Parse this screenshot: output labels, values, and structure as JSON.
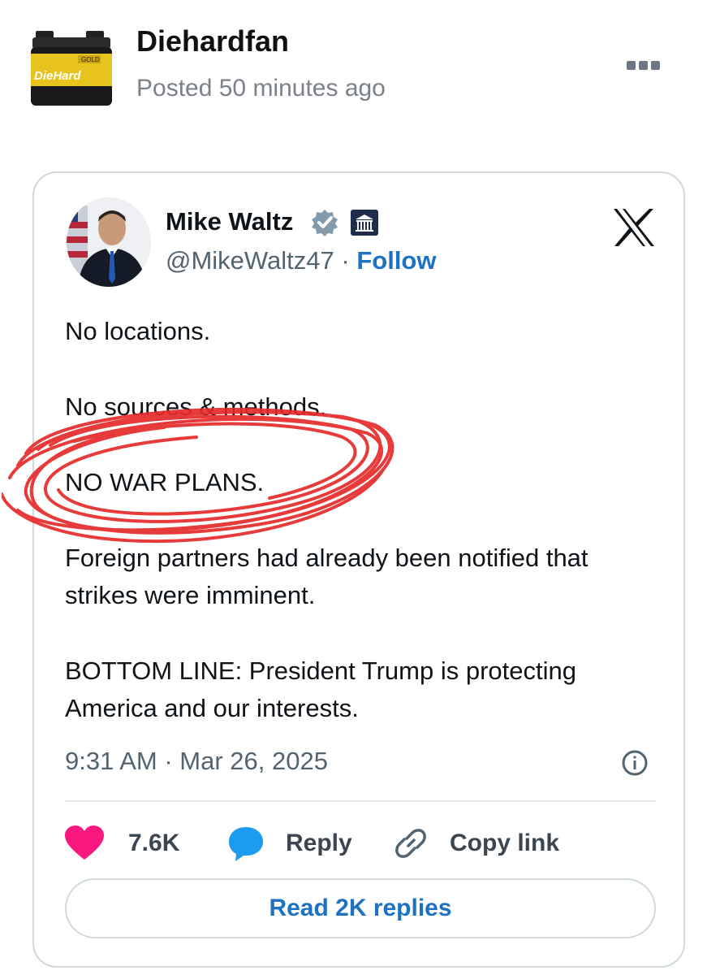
{
  "post": {
    "author": "Diehardfan",
    "posted": "Posted 50 minutes ago",
    "avatar_brand": "DieHard",
    "avatar_badge": "GOLD",
    "more_icon": "more-options-icon"
  },
  "tweet": {
    "author_name": "Mike Waltz",
    "handle": "@MikeWaltz47",
    "separator": " · ",
    "follow_label": "Follow",
    "lines": [
      "No locations.",
      "No sources & methods.",
      "NO WAR PLANS.",
      "Foreign partners had already been notified that strikes were imminent.",
      "BOTTOM LINE:  President Trump is protecting America and our interests."
    ],
    "timestamp": "9:31 AM · Mar 26, 2025",
    "likes": "7.6K",
    "reply_label": "Reply",
    "copy_link_label": "Copy link",
    "read_replies_label": "Read 2K replies",
    "colors": {
      "link": "#1d72c4",
      "heart": "#f91880",
      "reply_bubble": "#1d9bf0",
      "scribble": "#e52a2a"
    }
  }
}
